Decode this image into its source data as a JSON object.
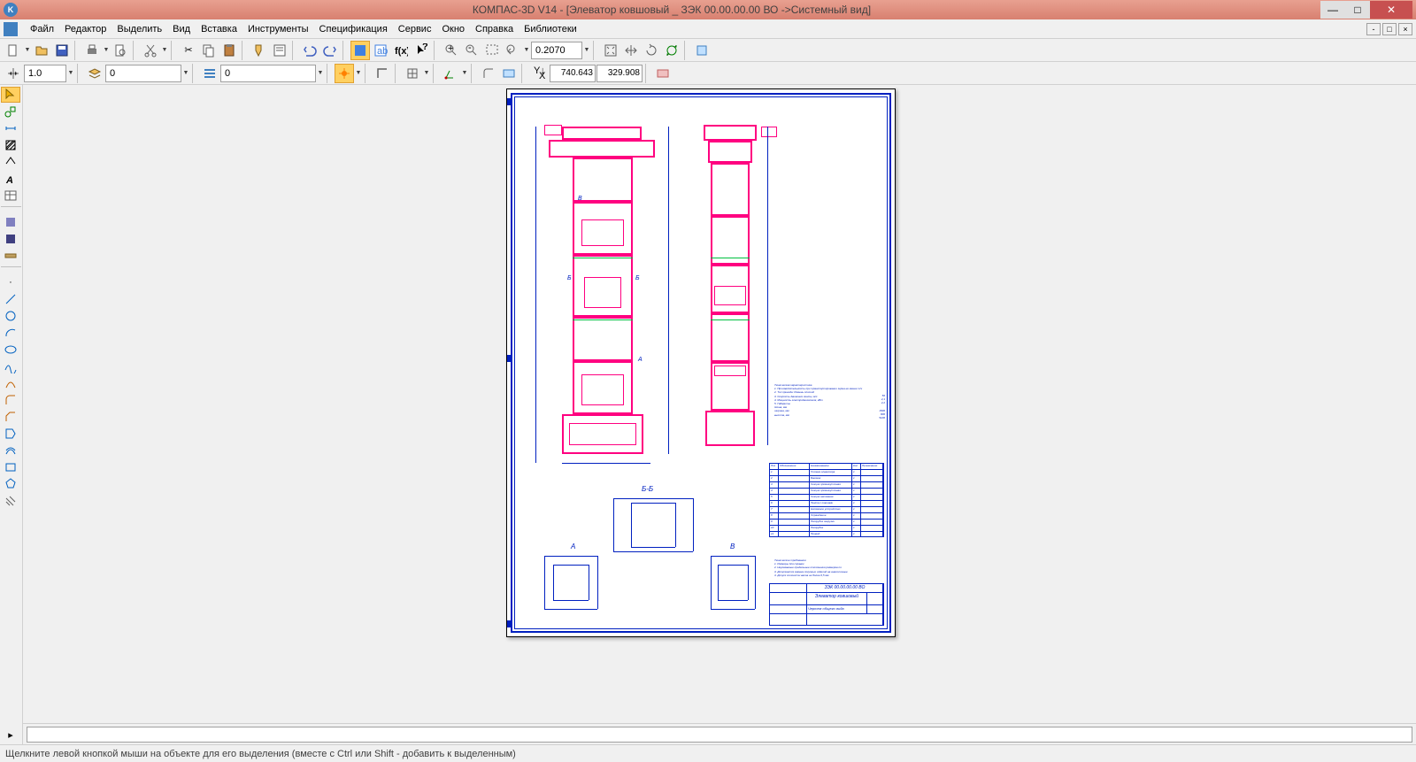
{
  "window": {
    "title": "КОМПАС-3D V14 - [Элеватор ковшовый _ ЗЭК 00.00.00.00 ВО ->Системный вид]",
    "app_badge": "K"
  },
  "menu": {
    "file": "Файл",
    "edit": "Редактор",
    "select": "Выделить",
    "view": "Вид",
    "insert": "Вставка",
    "tools": "Инструменты",
    "spec": "Спецификация",
    "service": "Сервис",
    "window": "Окно",
    "help": "Справка",
    "libs": "Библиотеки"
  },
  "toolbar2": {
    "scale_value": "1.0",
    "layer_value": "0",
    "style_value": "0",
    "zoom_value": "0.2070",
    "coord_x": "740.643",
    "coord_y": "329.908"
  },
  "drawing": {
    "section_BB": "Б-Б",
    "detail_A": "А",
    "detail_B": "В",
    "label_B1": "Б",
    "label_B2": "Б",
    "label_V": "В",
    "label_A": "А",
    "titleblock_num": "ЗЭК 00.00.00.00 ВО",
    "titleblock_name": "Элеватор ковшовый",
    "titleblock_sheet": "Чертеж общего вида",
    "notes1": "Техническая характеристика\n1. Производительность при транспортировании зерна не менее т/ч\n2. Тип привода: Ремень плоский\n3. Скорость движения ленты, м/с\n4. Мощность электродвигателя, кВт\n5. Габариты\nдлина, мм\nширина, мм\nвысота, мм",
    "notes1_vals": "50\n2,1\n2,2\n\n1500\n800\n5100",
    "spec_header": {
      "pos": "Поз",
      "obozn": "Обозначение",
      "naim": "Наименование",
      "kol": "Кол",
      "prim": "Примечание"
    },
    "spec_rows": [
      {
        "p": "1",
        "n": "Головка элеватора",
        "k": "1"
      },
      {
        "p": "2",
        "n": "Башмак",
        "k": "1"
      },
      {
        "p": "3",
        "n": "Секция промежуточная",
        "k": "1"
      },
      {
        "p": "4",
        "n": "Секция промежуточная",
        "k": "1"
      },
      {
        "p": "5",
        "n": "Секция натяжная",
        "k": "1"
      },
      {
        "p": "6",
        "n": "Лента с ковшами",
        "k": "1"
      },
      {
        "p": "7",
        "n": "Натяжное устройство",
        "k": "1"
      },
      {
        "p": "8",
        "n": "Ограждение",
        "k": "1"
      },
      {
        "p": "9",
        "n": "Патрубок загрузки",
        "k": "1"
      },
      {
        "p": "10",
        "n": "Патрубок",
        "k": "1"
      },
      {
        "p": "11",
        "n": "Привод",
        "k": "1"
      }
    ],
    "notes2": "Технические требования\n1. Размеры для справок\n2. Неуказанные предельные отклонения размеров по\n3. Допускается замена покупных изделий на аналогичные\n4. Допуск соосности валов не более 0,5 мм"
  },
  "status": {
    "hint": "Щелкните левой кнопкой мыши на объекте для его выделения (вместе с Ctrl или Shift - добавить к выделенным)"
  }
}
